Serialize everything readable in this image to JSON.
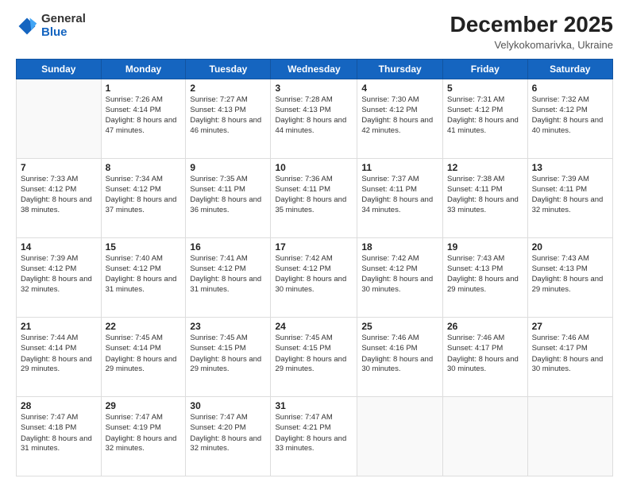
{
  "logo": {
    "general": "General",
    "blue": "Blue"
  },
  "header": {
    "month": "December 2025",
    "location": "Velykokomarivka, Ukraine"
  },
  "days_of_week": [
    "Sunday",
    "Monday",
    "Tuesday",
    "Wednesday",
    "Thursday",
    "Friday",
    "Saturday"
  ],
  "weeks": [
    [
      {
        "day": "",
        "sunrise": "",
        "sunset": "",
        "daylight": ""
      },
      {
        "day": "1",
        "sunrise": "Sunrise: 7:26 AM",
        "sunset": "Sunset: 4:14 PM",
        "daylight": "Daylight: 8 hours and 47 minutes."
      },
      {
        "day": "2",
        "sunrise": "Sunrise: 7:27 AM",
        "sunset": "Sunset: 4:13 PM",
        "daylight": "Daylight: 8 hours and 46 minutes."
      },
      {
        "day": "3",
        "sunrise": "Sunrise: 7:28 AM",
        "sunset": "Sunset: 4:13 PM",
        "daylight": "Daylight: 8 hours and 44 minutes."
      },
      {
        "day": "4",
        "sunrise": "Sunrise: 7:30 AM",
        "sunset": "Sunset: 4:12 PM",
        "daylight": "Daylight: 8 hours and 42 minutes."
      },
      {
        "day": "5",
        "sunrise": "Sunrise: 7:31 AM",
        "sunset": "Sunset: 4:12 PM",
        "daylight": "Daylight: 8 hours and 41 minutes."
      },
      {
        "day": "6",
        "sunrise": "Sunrise: 7:32 AM",
        "sunset": "Sunset: 4:12 PM",
        "daylight": "Daylight: 8 hours and 40 minutes."
      }
    ],
    [
      {
        "day": "7",
        "sunrise": "Sunrise: 7:33 AM",
        "sunset": "Sunset: 4:12 PM",
        "daylight": "Daylight: 8 hours and 38 minutes."
      },
      {
        "day": "8",
        "sunrise": "Sunrise: 7:34 AM",
        "sunset": "Sunset: 4:12 PM",
        "daylight": "Daylight: 8 hours and 37 minutes."
      },
      {
        "day": "9",
        "sunrise": "Sunrise: 7:35 AM",
        "sunset": "Sunset: 4:11 PM",
        "daylight": "Daylight: 8 hours and 36 minutes."
      },
      {
        "day": "10",
        "sunrise": "Sunrise: 7:36 AM",
        "sunset": "Sunset: 4:11 PM",
        "daylight": "Daylight: 8 hours and 35 minutes."
      },
      {
        "day": "11",
        "sunrise": "Sunrise: 7:37 AM",
        "sunset": "Sunset: 4:11 PM",
        "daylight": "Daylight: 8 hours and 34 minutes."
      },
      {
        "day": "12",
        "sunrise": "Sunrise: 7:38 AM",
        "sunset": "Sunset: 4:11 PM",
        "daylight": "Daylight: 8 hours and 33 minutes."
      },
      {
        "day": "13",
        "sunrise": "Sunrise: 7:39 AM",
        "sunset": "Sunset: 4:11 PM",
        "daylight": "Daylight: 8 hours and 32 minutes."
      }
    ],
    [
      {
        "day": "14",
        "sunrise": "Sunrise: 7:39 AM",
        "sunset": "Sunset: 4:12 PM",
        "daylight": "Daylight: 8 hours and 32 minutes."
      },
      {
        "day": "15",
        "sunrise": "Sunrise: 7:40 AM",
        "sunset": "Sunset: 4:12 PM",
        "daylight": "Daylight: 8 hours and 31 minutes."
      },
      {
        "day": "16",
        "sunrise": "Sunrise: 7:41 AM",
        "sunset": "Sunset: 4:12 PM",
        "daylight": "Daylight: 8 hours and 31 minutes."
      },
      {
        "day": "17",
        "sunrise": "Sunrise: 7:42 AM",
        "sunset": "Sunset: 4:12 PM",
        "daylight": "Daylight: 8 hours and 30 minutes."
      },
      {
        "day": "18",
        "sunrise": "Sunrise: 7:42 AM",
        "sunset": "Sunset: 4:12 PM",
        "daylight": "Daylight: 8 hours and 30 minutes."
      },
      {
        "day": "19",
        "sunrise": "Sunrise: 7:43 AM",
        "sunset": "Sunset: 4:13 PM",
        "daylight": "Daylight: 8 hours and 29 minutes."
      },
      {
        "day": "20",
        "sunrise": "Sunrise: 7:43 AM",
        "sunset": "Sunset: 4:13 PM",
        "daylight": "Daylight: 8 hours and 29 minutes."
      }
    ],
    [
      {
        "day": "21",
        "sunrise": "Sunrise: 7:44 AM",
        "sunset": "Sunset: 4:14 PM",
        "daylight": "Daylight: 8 hours and 29 minutes."
      },
      {
        "day": "22",
        "sunrise": "Sunrise: 7:45 AM",
        "sunset": "Sunset: 4:14 PM",
        "daylight": "Daylight: 8 hours and 29 minutes."
      },
      {
        "day": "23",
        "sunrise": "Sunrise: 7:45 AM",
        "sunset": "Sunset: 4:15 PM",
        "daylight": "Daylight: 8 hours and 29 minutes."
      },
      {
        "day": "24",
        "sunrise": "Sunrise: 7:45 AM",
        "sunset": "Sunset: 4:15 PM",
        "daylight": "Daylight: 8 hours and 29 minutes."
      },
      {
        "day": "25",
        "sunrise": "Sunrise: 7:46 AM",
        "sunset": "Sunset: 4:16 PM",
        "daylight": "Daylight: 8 hours and 30 minutes."
      },
      {
        "day": "26",
        "sunrise": "Sunrise: 7:46 AM",
        "sunset": "Sunset: 4:17 PM",
        "daylight": "Daylight: 8 hours and 30 minutes."
      },
      {
        "day": "27",
        "sunrise": "Sunrise: 7:46 AM",
        "sunset": "Sunset: 4:17 PM",
        "daylight": "Daylight: 8 hours and 30 minutes."
      }
    ],
    [
      {
        "day": "28",
        "sunrise": "Sunrise: 7:47 AM",
        "sunset": "Sunset: 4:18 PM",
        "daylight": "Daylight: 8 hours and 31 minutes."
      },
      {
        "day": "29",
        "sunrise": "Sunrise: 7:47 AM",
        "sunset": "Sunset: 4:19 PM",
        "daylight": "Daylight: 8 hours and 32 minutes."
      },
      {
        "day": "30",
        "sunrise": "Sunrise: 7:47 AM",
        "sunset": "Sunset: 4:20 PM",
        "daylight": "Daylight: 8 hours and 32 minutes."
      },
      {
        "day": "31",
        "sunrise": "Sunrise: 7:47 AM",
        "sunset": "Sunset: 4:21 PM",
        "daylight": "Daylight: 8 hours and 33 minutes."
      },
      {
        "day": "",
        "sunrise": "",
        "sunset": "",
        "daylight": ""
      },
      {
        "day": "",
        "sunrise": "",
        "sunset": "",
        "daylight": ""
      },
      {
        "day": "",
        "sunrise": "",
        "sunset": "",
        "daylight": ""
      }
    ]
  ]
}
